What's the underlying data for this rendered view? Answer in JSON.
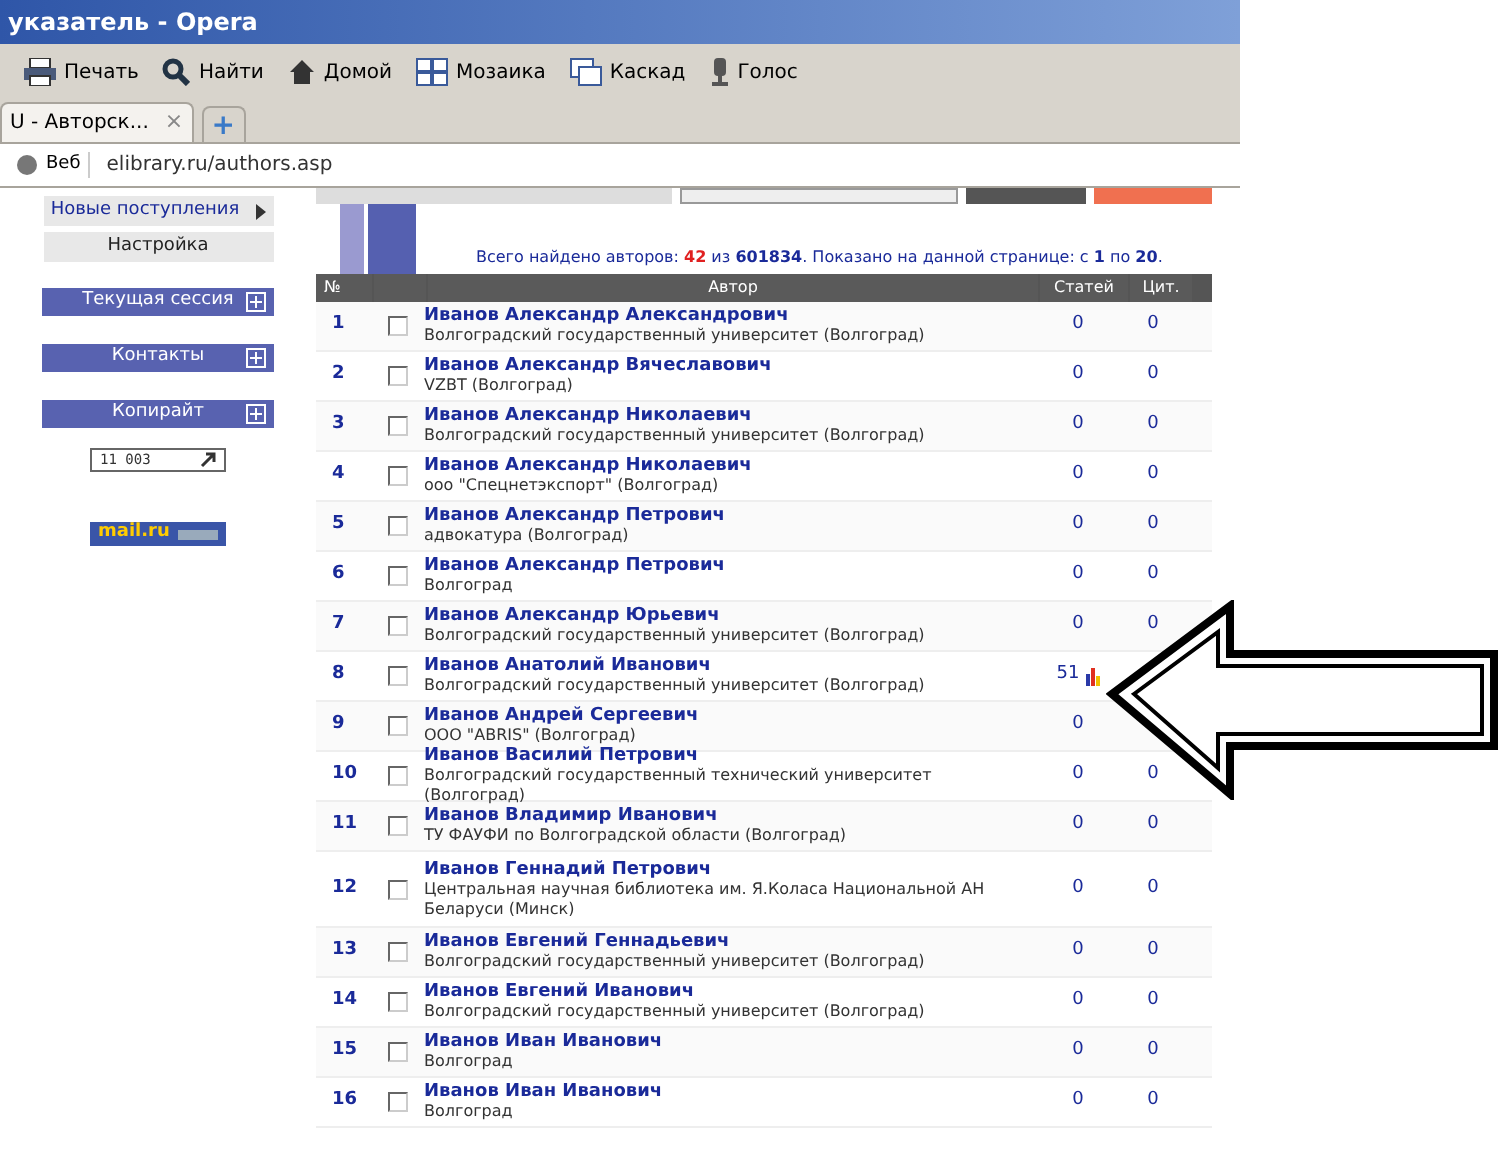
{
  "window": {
    "title": "указатель - Opera"
  },
  "toolbar": [
    {
      "label": "Печать",
      "kind": "print"
    },
    {
      "label": "Найти",
      "kind": "search"
    },
    {
      "label": "Домой",
      "kind": "home"
    },
    {
      "label": "Мозаика",
      "kind": "tile"
    },
    {
      "label": "Каскад",
      "kind": "cascade"
    },
    {
      "label": "Голос",
      "kind": "voice"
    }
  ],
  "tabs": [
    {
      "label": "U - Авторск...",
      "close": "×",
      "selected": true
    }
  ],
  "new_tab": "+",
  "address_bar": {
    "button": "Веб",
    "url": "elibrary.ru/authors.asp"
  },
  "sidebar": {
    "links": [
      {
        "label": "Новые поступления",
        "arrow": true
      },
      {
        "label": "Настройка",
        "arrow": false
      }
    ],
    "sections": [
      {
        "label": "Текущая сессия",
        "expanded": false
      },
      {
        "label": "Контакты",
        "expanded": false
      },
      {
        "label": "Копирайт",
        "expanded": false
      }
    ],
    "counter": "11 003",
    "badge": "mail.ru"
  },
  "summary": [
    {
      "text": "Всего найдено авторов: ",
      "kind": "plain"
    },
    {
      "text": "42",
      "kind": "highlight"
    },
    {
      "text": " из ",
      "kind": "plain"
    },
    {
      "text": "601834",
      "kind": "bold"
    },
    {
      "text": ".    Показано на данной странице: с ",
      "kind": "plain"
    },
    {
      "text": "1",
      "kind": "bold"
    },
    {
      "text": " по ",
      "kind": "plain"
    },
    {
      "text": "20",
      "kind": "bold"
    },
    {
      "text": ".",
      "kind": "plain"
    }
  ],
  "table": {
    "columns": [
      "№",
      "",
      "Автор",
      "Статей",
      "Цит."
    ],
    "rows": [
      {
        "num": "1",
        "checked": false,
        "name": "Иванов Александр Александрович",
        "org": "Волгоградский государственный университет (Волгоград)",
        "articles": "0",
        "citations": "0",
        "chart_icon": false
      },
      {
        "num": "2",
        "checked": false,
        "name": "Иванов Александр Вячеславович",
        "org": "VZBT (Волгоград)",
        "articles": "0",
        "citations": "0",
        "chart_icon": false
      },
      {
        "num": "3",
        "checked": false,
        "name": "Иванов Александр Николаевич",
        "org": "Волгоградский государственный университет (Волгоград)",
        "articles": "0",
        "citations": "0",
        "chart_icon": false
      },
      {
        "num": "4",
        "checked": false,
        "name": "Иванов Александр Николаевич",
        "org": "ооо \"Спецнетэкспорт\" (Волгоград)",
        "articles": "0",
        "citations": "0",
        "chart_icon": false
      },
      {
        "num": "5",
        "checked": false,
        "name": "Иванов Александр Петрович",
        "org": "адвокатура (Волгоград)",
        "articles": "0",
        "citations": "0",
        "chart_icon": false
      },
      {
        "num": "6",
        "checked": false,
        "name": "Иванов Александр Петрович",
        "org": "Волгоград",
        "articles": "0",
        "citations": "0",
        "chart_icon": false
      },
      {
        "num": "7",
        "checked": false,
        "name": "Иванов Александр Юрьевич",
        "org": "Волгоградский государственный университет (Волгоград)",
        "articles": "0",
        "citations": "0",
        "chart_icon": false
      },
      {
        "num": "8",
        "checked": false,
        "name": "Иванов Анатолий Иванович",
        "org": "Волгоградский государственный университет (Волгоград)",
        "articles": "51",
        "chart_icon": true
      },
      {
        "num": "9",
        "checked": false,
        "name": "Иванов Андрей Сергеевич",
        "org": "ООО \"ABRIS\" (Волгоград)",
        "articles": "0",
        "chart_icon": false
      },
      {
        "num": "10",
        "checked": false,
        "name": "Иванов Василий Петрович",
        "org": "Волгоградский государственный технический университет (Волгоград)",
        "articles": "0",
        "citations": "0",
        "chart_icon": false
      },
      {
        "num": "11",
        "checked": false,
        "name": "Иванов Владимир Иванович",
        "org": "ТУ ФАУФИ по Волгоградской области (Волгоград)",
        "articles": "0",
        "citations": "0",
        "chart_icon": false
      },
      {
        "num": "12",
        "checked": false,
        "name": "Иванов Геннадий Петрович",
        "org": "Центральная научная библиотека им. Я.Коласа Национальной АН Беларуси (Минск)",
        "articles": "0",
        "citations": "0",
        "chart_icon": false
      },
      {
        "num": "13",
        "checked": false,
        "name": "Иванов Евгений Геннадьевич",
        "org": "Волгоградский государственный университет (Волгоград)",
        "articles": "0",
        "citations": "0",
        "chart_icon": false
      },
      {
        "num": "14",
        "checked": false,
        "name": "Иванов Евгений Иванович",
        "org": "Волгоградский государственный университет (Волгоград)",
        "articles": "0",
        "citations": "0",
        "chart_icon": false
      },
      {
        "num": "15",
        "checked": false,
        "name": "Иванов Иван Иванович",
        "org": "Волгоград",
        "articles": "0",
        "citations": "0",
        "chart_icon": false
      },
      {
        "num": "16",
        "checked": false,
        "name": "Иванов Иван Иванович",
        "org": "Волгоград",
        "articles": "0",
        "citations": "0",
        "chart_icon": false
      }
    ]
  },
  "annotation": {
    "kind": "arrow-left"
  }
}
